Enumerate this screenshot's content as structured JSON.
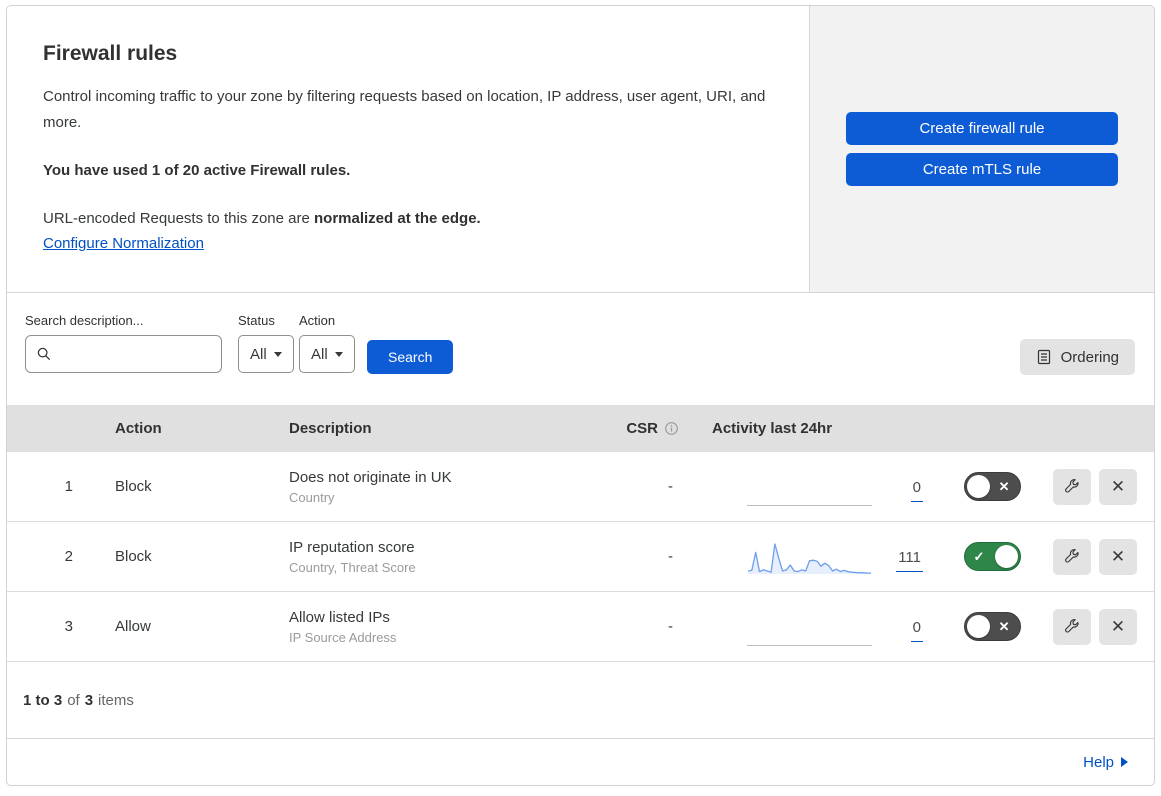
{
  "header": {
    "title": "Firewall rules",
    "description": "Control incoming traffic to your zone by filtering requests based on location, IP address, user agent, URI, and more.",
    "usage": "You have used 1 of 20 active Firewall rules.",
    "normalization_prefix": "URL-encoded Requests to this zone are ",
    "normalization_bold": "normalized at the edge.",
    "normalization_link": "Configure Normalization",
    "create_firewall_label": "Create firewall rule",
    "create_mtls_label": "Create mTLS rule"
  },
  "filters": {
    "search_label": "Search description...",
    "search_value": "",
    "status_label": "Status",
    "status_value": "All",
    "action_label": "Action",
    "action_value": "All",
    "search_button": "Search",
    "ordering_button": "Ordering"
  },
  "table": {
    "columns": {
      "action": "Action",
      "description": "Description",
      "csr": "CSR",
      "activity": "Activity last 24hr"
    },
    "rows": [
      {
        "num": "1",
        "action": "Block",
        "description": "Does not originate in UK",
        "criteria": "Country",
        "csr": "-",
        "activity": "0",
        "enabled": false,
        "sparkline": []
      },
      {
        "num": "2",
        "action": "Block",
        "description": "IP reputation score",
        "criteria": "Country, Threat Score",
        "csr": "-",
        "activity": "111",
        "enabled": true,
        "sparkline": [
          10,
          12,
          72,
          8,
          14,
          10,
          6,
          100,
          52,
          10,
          14,
          30,
          10,
          8,
          14,
          10,
          44,
          46,
          42,
          26,
          36,
          28,
          10,
          16,
          8,
          12,
          8,
          6,
          5,
          4,
          4,
          3,
          3
        ]
      },
      {
        "num": "3",
        "action": "Allow",
        "description": "Allow listed IPs",
        "criteria": "IP Source Address",
        "csr": "-",
        "activity": "0",
        "enabled": false,
        "sparkline": []
      }
    ]
  },
  "footer": {
    "range": "1 to 3",
    "of_text": "of",
    "total": "3",
    "items_text": "items",
    "help_label": "Help"
  },
  "colors": {
    "primary_blue": "#0d5cd6",
    "link_blue": "#0051c3",
    "toggle_on_green": "#2e8749",
    "toggle_off_gray": "#4d4d4d",
    "table_header_gray": "#e0e0e0",
    "side_panel_gray": "#f2f2f2",
    "sparkline_blue": "#6d9eeb"
  }
}
